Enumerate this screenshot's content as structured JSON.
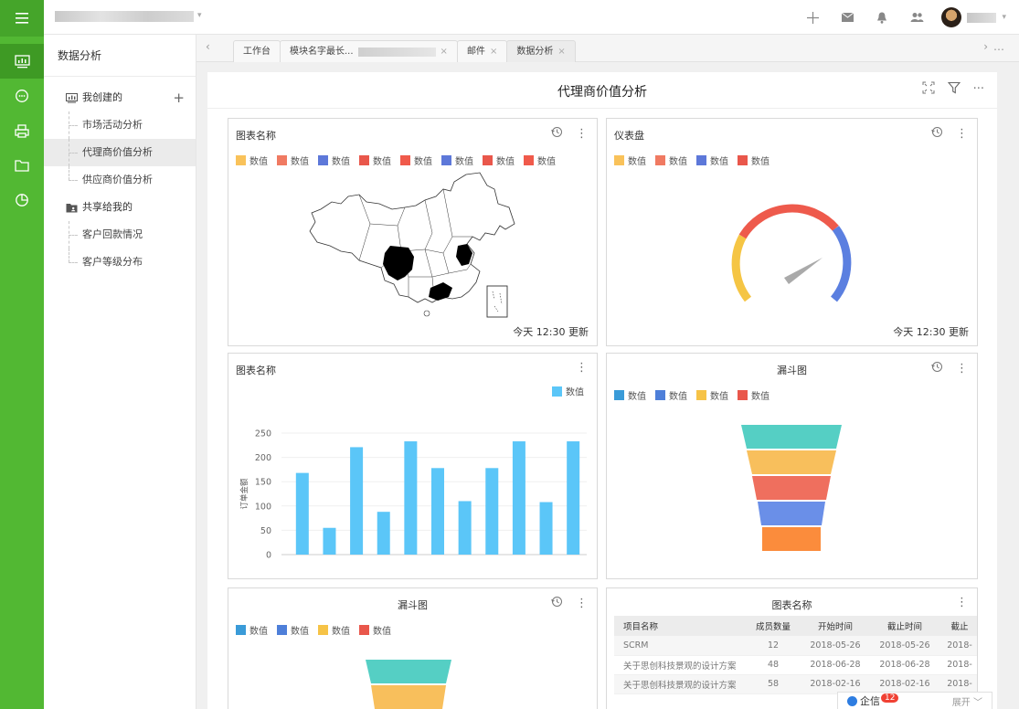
{
  "topbar": {
    "icons": [
      "plus-icon",
      "mail-icon",
      "bell-icon",
      "people-icon"
    ]
  },
  "sidebar": {
    "title": "数据分析",
    "groups": [
      {
        "label": "我创建的",
        "items": [
          "市场活动分析",
          "代理商价值分析",
          "供应商价值分析"
        ]
      },
      {
        "label": "共享给我的",
        "items": [
          "客户回款情况",
          "客户等级分布"
        ]
      }
    ]
  },
  "tabs": [
    {
      "label": "工作台",
      "close": false
    },
    {
      "label": "模块名字最长...",
      "close": true
    },
    {
      "label": "邮件",
      "close": true
    },
    {
      "label": "数据分析",
      "close": true
    }
  ],
  "main": {
    "title": "代理商价值分析"
  },
  "panels": {
    "map": {
      "title": "图表名称",
      "legend": [
        "数值",
        "数值",
        "数值",
        "数值",
        "数值",
        "数值",
        "数值",
        "数值"
      ],
      "legend_colors": [
        "#f9c25a",
        "#f07a62",
        "#5d78d9",
        "#e9574b",
        "#f05a4b",
        "#5d78d9",
        "#e9574b",
        "#f05a4b"
      ],
      "updated": "今天 12:30 更新"
    },
    "gauge": {
      "title": "仪表盘",
      "legend": [
        "数值",
        "数值",
        "数值",
        "数值"
      ],
      "legend_colors": [
        "#f9c25a",
        "#f07a62",
        "#5d78d9",
        "#e9574b"
      ],
      "updated": "今天 12:30 更新"
    },
    "bar": {
      "title": "图表名称"
    },
    "funnel1": {
      "title": "漏斗图",
      "legend": [
        "数值",
        "数值",
        "数值",
        "数值"
      ],
      "legend_colors": [
        "#3a9bd8",
        "#4e7fd9",
        "#f6c347",
        "#e9574b"
      ]
    },
    "funnel2": {
      "title": "漏斗图",
      "legend": [
        "数值",
        "数值",
        "数值",
        "数值"
      ],
      "legend_colors": [
        "#3a9bd8",
        "#4e7fd9",
        "#f6c347",
        "#e9574b"
      ]
    },
    "table": {
      "title": "图表名称",
      "columns": [
        "项目名称",
        "成员数量",
        "开始时间",
        "截止时间",
        "截止"
      ],
      "rows": [
        [
          "SCRM",
          "12",
          "2018-05-26",
          "2018-05-26",
          "2018-"
        ],
        [
          "关于思创科技景观的设计方案",
          "48",
          "2018-06-28",
          "2018-06-28",
          "2018-"
        ],
        [
          "关于思创科技景观的设计方案",
          "58",
          "2018-02-16",
          "2018-02-16",
          "2018-"
        ]
      ]
    }
  },
  "chart_data": {
    "type": "bar",
    "title": "",
    "ylabel": "订单金额",
    "yticks": [
      "250",
      "200",
      "150",
      "100",
      "50",
      "0"
    ],
    "ylim": [
      0,
      250
    ],
    "series": [
      {
        "name": "数值",
        "values": [
          168,
          55,
          221,
          88,
          233,
          178,
          110,
          178,
          233,
          108,
          233
        ]
      }
    ],
    "bar_color": "#5bc6f8",
    "grid": true,
    "legend_position": "top-right"
  },
  "chat": {
    "label": "企信",
    "badge": "12",
    "expand": "展开"
  }
}
